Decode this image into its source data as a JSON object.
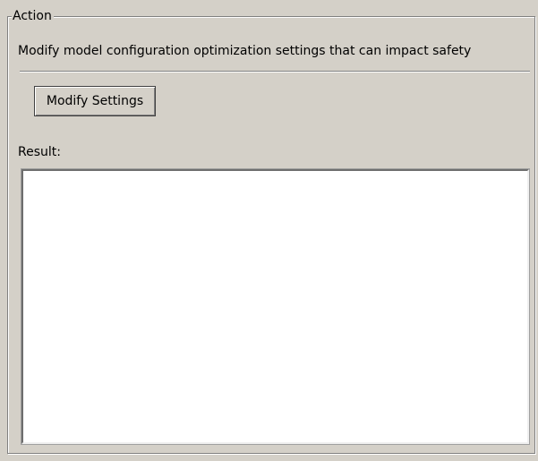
{
  "group": {
    "title": "Action"
  },
  "action": {
    "description": "Modify model configuration optimization settings that can impact safety",
    "button_label": "Modify Settings"
  },
  "result": {
    "label": "Result:",
    "value": ""
  }
}
